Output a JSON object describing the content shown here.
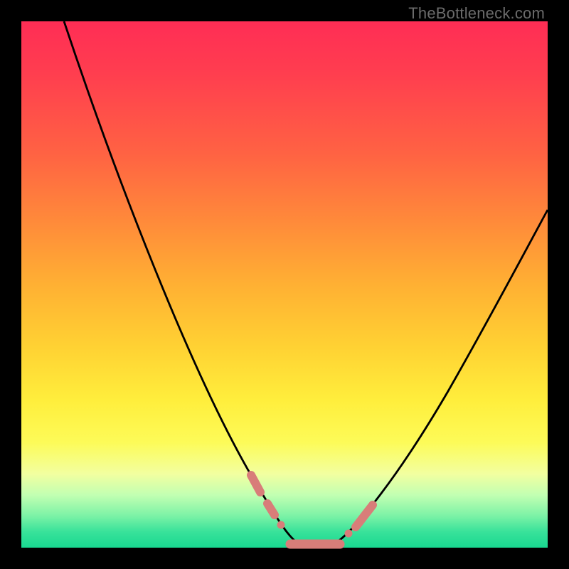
{
  "watermark": "TheBottleneck.com",
  "colors": {
    "background": "#000000",
    "gradient_top": "#ff2d55",
    "gradient_mid": "#ffd233",
    "gradient_bottom": "#19d890",
    "curve": "#000000",
    "marker": "#d87d79"
  },
  "chart_data": {
    "type": "line",
    "title": "",
    "xlabel": "",
    "ylabel": "",
    "xlim": [
      0,
      100
    ],
    "ylim": [
      0,
      100
    ],
    "grid": false,
    "series": [
      {
        "name": "bottleneck-curve",
        "x": [
          8,
          12,
          16,
          20,
          24,
          28,
          32,
          36,
          40,
          44,
          48,
          50,
          52,
          54,
          56,
          58,
          60,
          62,
          66,
          70,
          74,
          78,
          82,
          86,
          90,
          94,
          98,
          100
        ],
        "y": [
          100,
          89,
          78,
          67,
          56,
          46,
          36,
          27,
          19,
          12,
          6,
          3,
          1,
          0,
          0,
          0,
          0,
          1,
          3,
          7,
          12,
          18,
          25,
          32,
          40,
          48,
          56,
          60
        ]
      }
    ],
    "markers": [
      {
        "name": "left-segment-upper",
        "x_range": [
          44,
          46
        ],
        "y_range": [
          10,
          13
        ]
      },
      {
        "name": "left-segment-lower",
        "x_range": [
          47,
          49
        ],
        "y_range": [
          4,
          8
        ]
      },
      {
        "name": "trough-floor",
        "x_range": [
          51,
          61
        ],
        "y_range": [
          0,
          1
        ]
      },
      {
        "name": "right-segment",
        "x_range": [
          63,
          67
        ],
        "y_range": [
          3,
          8
        ]
      }
    ]
  }
}
